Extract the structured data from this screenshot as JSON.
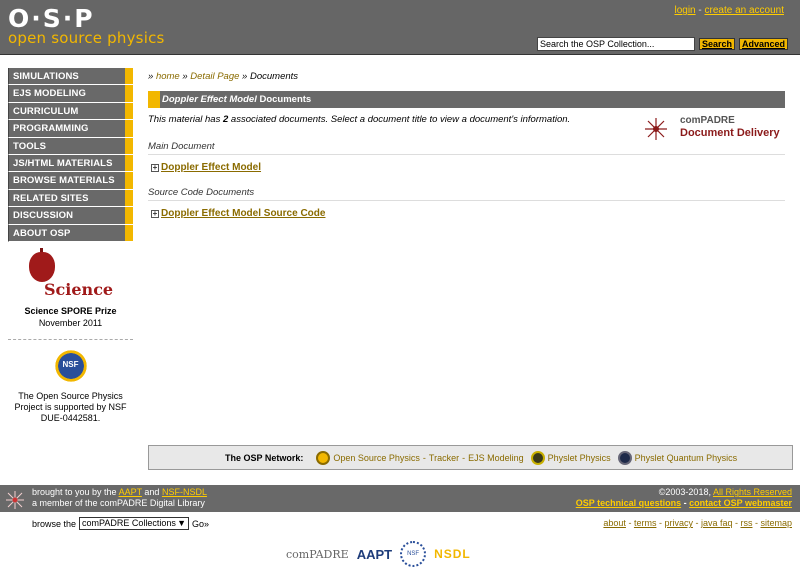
{
  "header": {
    "logo_top": "O·S·P",
    "logo_sub": "open source physics",
    "login": "login",
    "separator": " - ",
    "create_account": "create an account",
    "search_value": "Search the OSP Collection...",
    "search_button": "Search",
    "advanced_button": "Advanced"
  },
  "sidebar": {
    "items": [
      {
        "label": "SIMULATIONS"
      },
      {
        "label": "EJS MODELING"
      },
      {
        "label": "CURRICULUM"
      },
      {
        "label": "PROGRAMMING"
      },
      {
        "label": "TOOLS"
      },
      {
        "label": "JS/HTML MATERIALS"
      },
      {
        "label": "BROWSE MATERIALS"
      },
      {
        "label": "RELATED SITES"
      },
      {
        "label": "DISCUSSION"
      },
      {
        "label": "ABOUT OSP"
      }
    ],
    "spore_logo_text": "Science",
    "spore_title": "Science SPORE Prize",
    "spore_date": "November 2011",
    "nsf_logo_text": "NSF",
    "nsf_text": "The Open Source Physics Project is supported by NSF DUE-0442581."
  },
  "main": {
    "breadcrumb": {
      "home": "home",
      "detail": "Detail Page",
      "current": "Documents",
      "sep": "»"
    },
    "title_italic": "Doppler Effect Model",
    "title_rest": " Documents",
    "intro_pre": "This material has ",
    "intro_count": "2",
    "intro_post": " associated documents.  Select a document title to view a document's information.",
    "compadre_line1": "comPADRE",
    "compadre_line2": "Document Delivery",
    "main_doc_label": "Main Document",
    "main_doc_link": "Doppler Effect Model",
    "source_doc_label": "Source Code Documents",
    "source_doc_link": "Doppler Effect Model Source Code"
  },
  "network": {
    "label": "The OSP Network:",
    "osp": "Open Source Physics",
    "tracker": "Tracker",
    "ejs": "EJS Modeling",
    "physlet": "Physlet Physics",
    "quantum": "Physlet Quantum Physics",
    "dash": " - "
  },
  "footer": {
    "brought": "brought to you by the ",
    "aapt": "AAPT",
    "and": " and ",
    "nsf_nsdl": "NSF-NSDL",
    "member": "a member of the comPADRE Digital Library",
    "copyright": "©2003-2018, ",
    "rights": "All Rights Reserved",
    "tech_questions": "OSP technical questions",
    "contact": "contact OSP webmaster",
    "browse_label": "browse the",
    "browse_select": "comPADRE Collections",
    "go": "Go»",
    "links": {
      "about": "about",
      "terms": "terms",
      "privacy": "privacy",
      "java_faq": "java faq",
      "rss": "rss",
      "sitemap": "sitemap"
    },
    "partner_compadre": "comPADRE",
    "partner_aapt": "AAPT",
    "partner_nsf": "NSF",
    "partner_nsdl": "NSDL"
  },
  "colors": {
    "header_gray": "#666666",
    "accent_gold": "#f2b700",
    "link_gold": "#8a6b00",
    "nav_gray": "#696969"
  }
}
